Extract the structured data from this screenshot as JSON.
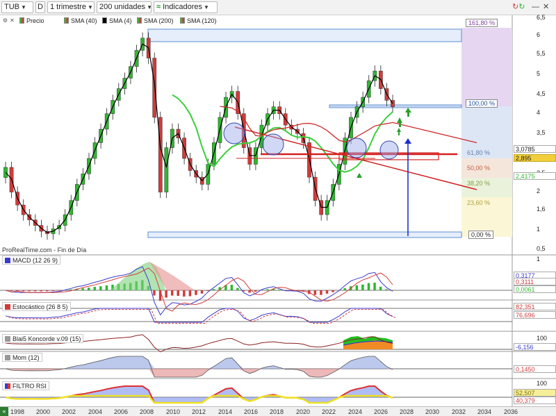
{
  "toolbar": {
    "symbol": "TUB",
    "d_button": "D",
    "period": "1 trimestre",
    "units": "200 unidades",
    "indicators": "Indicadores"
  },
  "price_legend": {
    "price": "Precio",
    "sma40": "SMA (40)",
    "sma4": "SMA (4)",
    "sma200": "SMA (200)",
    "sma120": "SMA (120)"
  },
  "source": "ProRealTime.com - Fin de Día",
  "panels": {
    "macd": "MACD (12 26 9)",
    "stoch": "Estocástico (26 8 5)",
    "koncorde": "Blai5 Koncorde v.09 (15)",
    "mom": "Mom (12)",
    "rsi": "FILTRO RSI"
  },
  "colors": {
    "up": "#2fb82f",
    "down": "#d23b3b",
    "sma": "#000000",
    "sma_green": "#3ccf3c",
    "trend": "#d42020",
    "fib_box": "#cfe0f5",
    "arrow_blue": "#1f2fd0",
    "arrow_green": "#2aa02a"
  },
  "price_axis": [
    "6,5",
    "6",
    "5,5",
    "5",
    "4,5",
    "4",
    "3,5",
    "3",
    "2,5",
    "2",
    "1,6",
    "1",
    "0,5"
  ],
  "price_values": {
    "last": "3,0785",
    "close": "2,895",
    "sma": "2,4175"
  },
  "fib": {
    "f1618": "161,80 %",
    "f100": "100,00 %",
    "f618": "61,80 %",
    "f50": "50,00 %",
    "f382": "38,20 %",
    "f236": "23,60 %",
    "f0": "0,00 %"
  },
  "macd_axis": {
    "top": "1",
    "v1": "0,3177",
    "v2": "0,3111",
    "v3": "0,0061"
  },
  "stoch_axis": {
    "v1": "82,351",
    "v2": "76,696"
  },
  "koncorde_axis": {
    "top": "100",
    "v1": "-6,156"
  },
  "mom_axis": {
    "v1": "0,1450"
  },
  "rsi_axis": {
    "top": "100",
    "v1": "52,507",
    "v2": "40,379"
  },
  "xaxis": {
    "nav": "«",
    "years": [
      "1998",
      "2000",
      "2002",
      "2004",
      "2006",
      "2008",
      "2010",
      "2012",
      "2014",
      "2016",
      "2018",
      "2020",
      "2022",
      "2024",
      "2026",
      "2028",
      "2030",
      "2032",
      "2034",
      "2036"
    ]
  },
  "series": {
    "close": [
      1.55,
      1.2,
      1.05,
      0.95,
      0.9,
      0.85,
      0.8,
      0.78,
      0.82,
      0.85,
      0.95,
      1.1,
      1.3,
      1.45,
      1.7,
      2.0,
      2.3,
      2.7,
      3.1,
      3.5,
      3.9,
      4.4,
      5.2,
      5.9,
      4.8,
      2.6,
      1.2,
      1.9,
      2.3,
      2.1,
      1.7,
      1.5,
      1.4,
      1.3,
      1.6,
      2.0,
      2.6,
      3.2,
      3.4,
      2.7,
      1.9,
      1.6,
      1.9,
      2.4,
      2.7,
      2.9,
      2.7,
      2.4,
      2.3,
      2.2,
      2.0,
      1.4,
      1.1,
      0.95,
      1.1,
      1.3,
      1.6,
      2.1,
      2.6,
      2.9,
      3.2,
      3.8,
      4.2,
      3.5,
      3.1,
      2.9
    ]
  }
}
